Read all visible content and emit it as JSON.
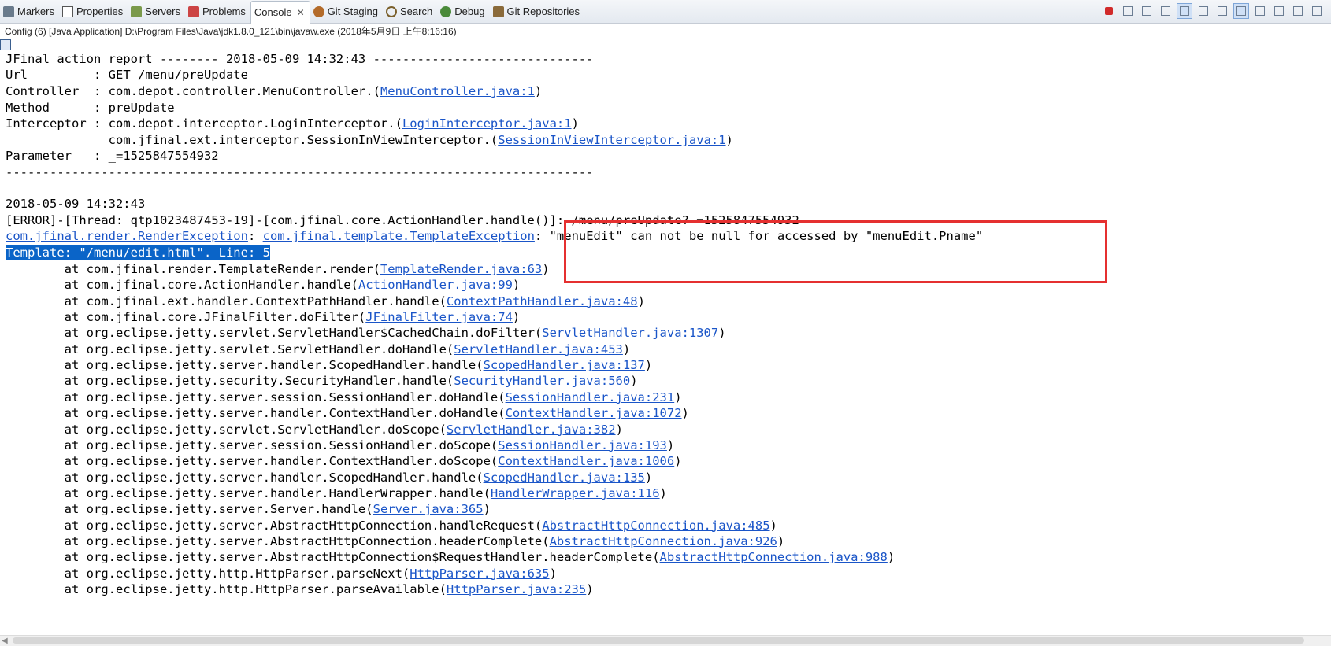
{
  "tabs": [
    {
      "label": "Markers",
      "icon": "markers-icon"
    },
    {
      "label": "Properties",
      "icon": "properties-icon"
    },
    {
      "label": "Servers",
      "icon": "servers-icon"
    },
    {
      "label": "Problems",
      "icon": "problems-icon"
    },
    {
      "label": "Console",
      "icon": "console-icon",
      "active": true
    },
    {
      "label": "Git Staging",
      "icon": "git-staging-icon"
    },
    {
      "label": "Search",
      "icon": "search-icon"
    },
    {
      "label": "Debug",
      "icon": "debug-icon"
    },
    {
      "label": "Git Repositories",
      "icon": "git-repositories-icon"
    }
  ],
  "close_glyph": "✕",
  "status_line": "Config (6) [Java Application] D:\\Program Files\\Java\\jdk1.8.0_121\\bin\\javaw.exe (2018年5月9日 上午8:16:16)",
  "report": {
    "header": "JFinal action report -------- 2018-05-09 14:32:43 ------------------------------",
    "url_label": "Url         : ",
    "url_value": "GET /menu/preUpdate",
    "controller_label": "Controller  : ",
    "controller_prefix": "com.depot.controller.MenuController.(",
    "controller_link": "MenuController.java:1",
    "method_label": "Method      : ",
    "method_value": "preUpdate",
    "interceptor_label": "Interceptor : ",
    "interceptor1_prefix": "com.depot.interceptor.LoginInterceptor.(",
    "interceptor1_link": "LoginInterceptor.java:1",
    "interceptor2_indent": "              ",
    "interceptor2_prefix": "com.jfinal.ext.interceptor.SessionInViewInterceptor.(",
    "interceptor2_link": "SessionInViewInterceptor.java:1",
    "parameter_label": "Parameter   : ",
    "parameter_value": "_=1525847554932",
    "footer": "--------------------------------------------------------------------------------"
  },
  "error": {
    "timestamp": "2018-05-09 14:32:43",
    "line": "[ERROR]-[Thread: qtp1023487453-19]-[com.jfinal.core.ActionHandler.handle()]: /menu/preUpdate?_=1525847554932",
    "exception1": "com.jfinal.render.RenderException",
    "sep": ": ",
    "exception2": "com.jfinal.template.TemplateException",
    "message": ": \"menuEdit\" can not be null for accessed by \"menuEdit.Pname\"",
    "template_line": "Template: \"/menu/edit.html\". Line: 5"
  },
  "trace_indent": "        at ",
  "trace": [
    {
      "prefix": "com.jfinal.render.TemplateRender.render(",
      "link": "TemplateRender.java:63"
    },
    {
      "prefix": "com.jfinal.core.ActionHandler.handle(",
      "link": "ActionHandler.java:99"
    },
    {
      "prefix": "com.jfinal.ext.handler.ContextPathHandler.handle(",
      "link": "ContextPathHandler.java:48"
    },
    {
      "prefix": "com.jfinal.core.JFinalFilter.doFilter(",
      "link": "JFinalFilter.java:74"
    },
    {
      "prefix": "org.eclipse.jetty.servlet.ServletHandler$CachedChain.doFilter(",
      "link": "ServletHandler.java:1307"
    },
    {
      "prefix": "org.eclipse.jetty.servlet.ServletHandler.doHandle(",
      "link": "ServletHandler.java:453"
    },
    {
      "prefix": "org.eclipse.jetty.server.handler.ScopedHandler.handle(",
      "link": "ScopedHandler.java:137"
    },
    {
      "prefix": "org.eclipse.jetty.security.SecurityHandler.handle(",
      "link": "SecurityHandler.java:560"
    },
    {
      "prefix": "org.eclipse.jetty.server.session.SessionHandler.doHandle(",
      "link": "SessionHandler.java:231"
    },
    {
      "prefix": "org.eclipse.jetty.server.handler.ContextHandler.doHandle(",
      "link": "ContextHandler.java:1072"
    },
    {
      "prefix": "org.eclipse.jetty.servlet.ServletHandler.doScope(",
      "link": "ServletHandler.java:382"
    },
    {
      "prefix": "org.eclipse.jetty.server.session.SessionHandler.doScope(",
      "link": "SessionHandler.java:193"
    },
    {
      "prefix": "org.eclipse.jetty.server.handler.ContextHandler.doScope(",
      "link": "ContextHandler.java:1006"
    },
    {
      "prefix": "org.eclipse.jetty.server.handler.ScopedHandler.handle(",
      "link": "ScopedHandler.java:135"
    },
    {
      "prefix": "org.eclipse.jetty.server.handler.HandlerWrapper.handle(",
      "link": "HandlerWrapper.java:116"
    },
    {
      "prefix": "org.eclipse.jetty.server.Server.handle(",
      "link": "Server.java:365"
    },
    {
      "prefix": "org.eclipse.jetty.server.AbstractHttpConnection.handleRequest(",
      "link": "AbstractHttpConnection.java:485"
    },
    {
      "prefix": "org.eclipse.jetty.server.AbstractHttpConnection.headerComplete(",
      "link": "AbstractHttpConnection.java:926"
    },
    {
      "prefix": "org.eclipse.jetty.server.AbstractHttpConnection$RequestHandler.headerComplete(",
      "link": "AbstractHttpConnection.java:988"
    },
    {
      "prefix": "org.eclipse.jetty.http.HttpParser.parseNext(",
      "link": "HttpParser.java:635"
    },
    {
      "prefix": "org.eclipse.jetty.http.HttpParser.parseAvailable(",
      "link": "HttpParser.java:235"
    }
  ],
  "close_paren": ")",
  "colors": {
    "link": "#1a55c8",
    "selection": "#0a64c8",
    "highlight_box": "#e53030"
  }
}
